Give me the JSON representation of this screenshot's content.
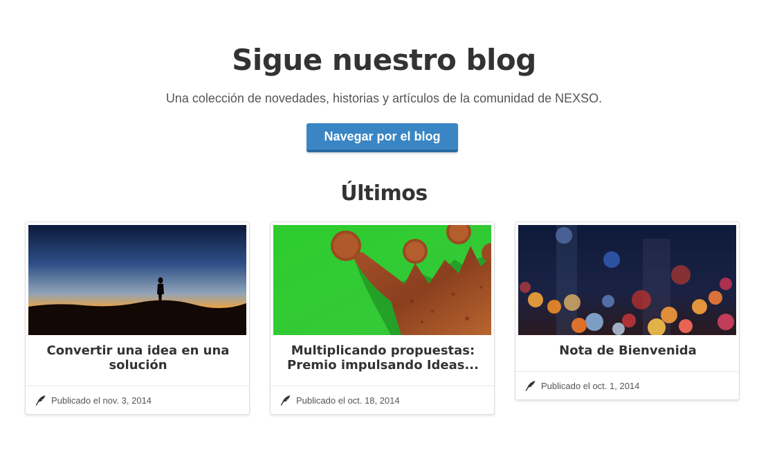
{
  "header": {
    "title": "Sigue nuestro blog",
    "subtitle": "Una colección de novedades, historias y artículos de la comunidad de NEXSO.",
    "cta_label": "Navegar por el blog"
  },
  "latest": {
    "heading": "Últimos",
    "posts": [
      {
        "title": "Convertir una idea en una solución",
        "published": "Publicado el nov. 3, 2014",
        "image": "sunset-silhouette"
      },
      {
        "title": "Multiplicando propuestas: Premio impulsando Ideas...",
        "published": "Publicado el oct. 18, 2014",
        "image": "rusty-crown-on-green"
      },
      {
        "title": "Nota de Bienvenida",
        "published": "Publicado el oct. 1, 2014",
        "image": "city-bokeh-lights"
      }
    ]
  },
  "colors": {
    "button": "#3a86c4",
    "button_border": "#2a6aa0",
    "text": "#333333",
    "muted": "#555555"
  },
  "icons": {
    "meta": "quill-feather-icon"
  }
}
